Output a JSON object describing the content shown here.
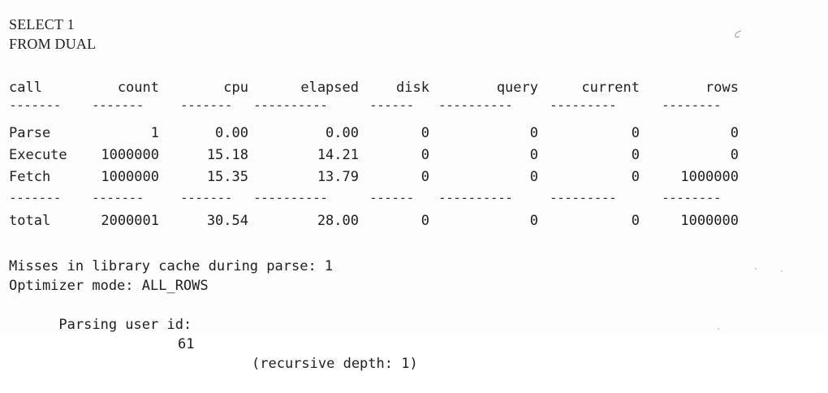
{
  "sql": {
    "line1": "SELECT 1",
    "line2": "FROM DUAL"
  },
  "table": {
    "headers": [
      "call",
      "count",
      "cpu",
      "elapsed",
      "disk",
      "query",
      "current",
      "rows"
    ],
    "separator": [
      "-------",
      "-------",
      "-------",
      "----------",
      "------",
      "----------",
      "---------",
      "--------"
    ],
    "rows": [
      [
        "Parse",
        "1",
        "0.00",
        "0.00",
        "0",
        "0",
        "0",
        "0"
      ],
      [
        "Execute",
        "1000000",
        "15.18",
        "14.21",
        "0",
        "0",
        "0",
        "0"
      ],
      [
        "Fetch",
        "1000000",
        "15.35",
        "13.79",
        "0",
        "0",
        "0",
        "1000000"
      ]
    ],
    "total": [
      "total",
      "2000001",
      "30.54",
      "28.00",
      "0",
      "0",
      "0",
      "1000000"
    ]
  },
  "footer": {
    "misses": "Misses in library cache during parse: 1",
    "optimizer": "Optimizer mode: ALL_ROWS",
    "parsing_label": "Parsing user id:",
    "parsing_value": "61",
    "recursive": "(recursive depth: 1)"
  }
}
